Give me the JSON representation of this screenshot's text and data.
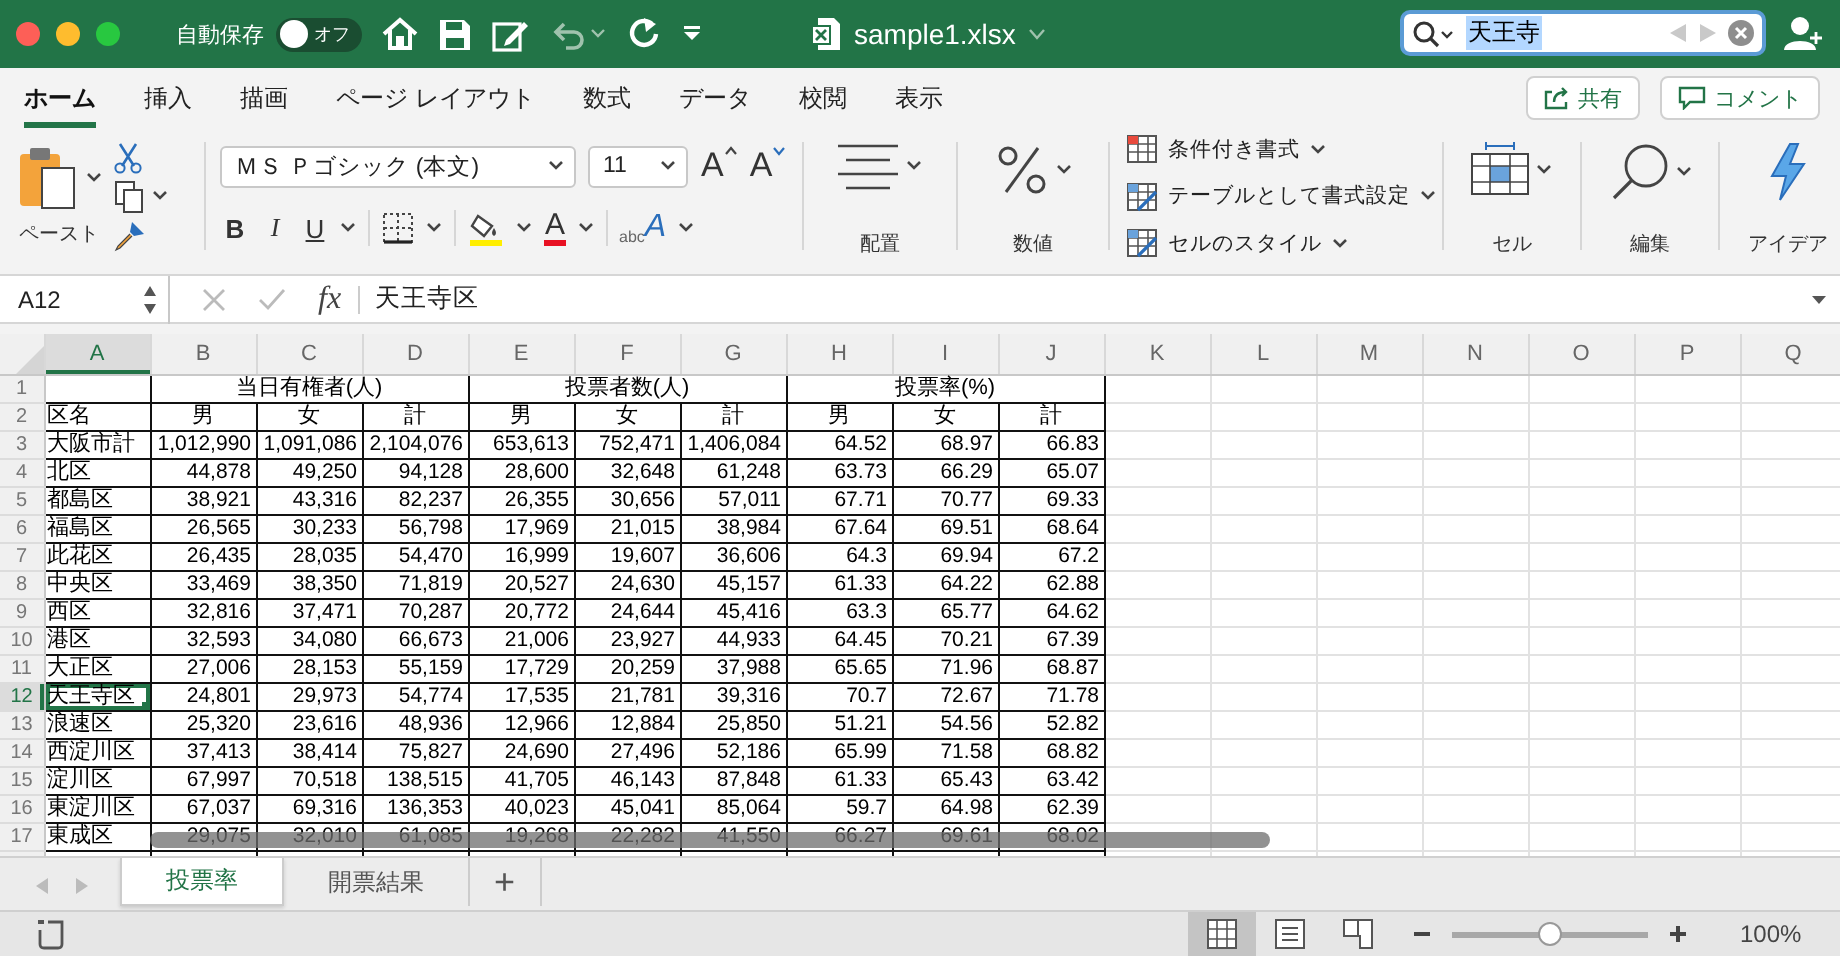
{
  "title_bar": {
    "autosave": {
      "label": "自動保存",
      "state_label": "オフ",
      "on": false
    },
    "filename": "sample1.xlsx",
    "search": {
      "value": "天王寺"
    }
  },
  "ribbon_tabs": [
    {
      "label": "ホーム",
      "selected": true
    },
    {
      "label": "挿入",
      "selected": false
    },
    {
      "label": "描画",
      "selected": false
    },
    {
      "label": "ページ レイアウト",
      "selected": false
    },
    {
      "label": "数式",
      "selected": false
    },
    {
      "label": "データ",
      "selected": false
    },
    {
      "label": "校閲",
      "selected": false
    },
    {
      "label": "表示",
      "selected": false
    }
  ],
  "share_button": "共有",
  "comment_button": "コメント",
  "ribbon": {
    "paste_label": "ペースト",
    "font_name": "ＭＳ Ｐゴシック (本文)",
    "font_size": "11",
    "grow_font": "A",
    "shrink_font": "A",
    "style_buttons": [
      "B",
      "I",
      "U"
    ],
    "font_color": "A",
    "orientation": {
      "small": "abc",
      "large": "A"
    },
    "alignment_label": "配置",
    "number_label": "数値",
    "styles": [
      "条件付き書式",
      "テーブルとして書式設定",
      "セルのスタイル"
    ],
    "cells_label": "セル",
    "editing_label": "編集",
    "ideas_label": "アイデア"
  },
  "formula_bar": {
    "name_box": "A12",
    "function_label": "fx",
    "formula": "天王寺区"
  },
  "sheet": {
    "columns": [
      {
        "letter": "A",
        "selected": true
      },
      {
        "letter": "B",
        "selected": false
      },
      {
        "letter": "C",
        "selected": false
      },
      {
        "letter": "D",
        "selected": false
      },
      {
        "letter": "E",
        "selected": false
      },
      {
        "letter": "F",
        "selected": false
      },
      {
        "letter": "G",
        "selected": false
      },
      {
        "letter": "H",
        "selected": false
      },
      {
        "letter": "I",
        "selected": false
      },
      {
        "letter": "J",
        "selected": false
      },
      {
        "letter": "K",
        "selected": false
      },
      {
        "letter": "L",
        "selected": false
      },
      {
        "letter": "M",
        "selected": false
      },
      {
        "letter": "N",
        "selected": false
      },
      {
        "letter": "O",
        "selected": false
      },
      {
        "letter": "P",
        "selected": false
      },
      {
        "letter": "Q",
        "selected": false
      }
    ],
    "header_rows": [
      {
        "number": "1",
        "selected": false
      },
      {
        "number": "2",
        "selected": false
      }
    ],
    "name_column_label": "区名",
    "groups": [
      {
        "label": "当日有権者(人)",
        "subcolumns": [
          "男",
          "女",
          "計"
        ]
      },
      {
        "label": "投票者数(人)",
        "subcolumns": [
          "男",
          "女",
          "計"
        ]
      },
      {
        "label": "投票率(%)",
        "subcolumns": [
          "男",
          "女",
          "計"
        ]
      }
    ],
    "rows": [
      {
        "number": "3",
        "selected": false,
        "cells": [
          "大阪市計",
          "1,012,990",
          "1,091,086",
          "2,104,076",
          "653,613",
          "752,471",
          "1,406,084",
          "64.52",
          "68.97",
          "66.83"
        ]
      },
      {
        "number": "4",
        "selected": false,
        "cells": [
          "北区",
          "44,878",
          "49,250",
          "94,128",
          "28,600",
          "32,648",
          "61,248",
          "63.73",
          "66.29",
          "65.07"
        ]
      },
      {
        "number": "5",
        "selected": false,
        "cells": [
          "都島区",
          "38,921",
          "43,316",
          "82,237",
          "26,355",
          "30,656",
          "57,011",
          "67.71",
          "70.77",
          "69.33"
        ]
      },
      {
        "number": "6",
        "selected": false,
        "cells": [
          "福島区",
          "26,565",
          "30,233",
          "56,798",
          "17,969",
          "21,015",
          "38,984",
          "67.64",
          "69.51",
          "68.64"
        ]
      },
      {
        "number": "7",
        "selected": false,
        "cells": [
          "此花区",
          "26,435",
          "28,035",
          "54,470",
          "16,999",
          "19,607",
          "36,606",
          "64.3",
          "69.94",
          "67.2"
        ]
      },
      {
        "number": "8",
        "selected": false,
        "cells": [
          "中央区",
          "33,469",
          "38,350",
          "71,819",
          "20,527",
          "24,630",
          "45,157",
          "61.33",
          "64.22",
          "62.88"
        ]
      },
      {
        "number": "9",
        "selected": false,
        "cells": [
          "西区",
          "32,816",
          "37,471",
          "70,287",
          "20,772",
          "24,644",
          "45,416",
          "63.3",
          "65.77",
          "64.62"
        ]
      },
      {
        "number": "10",
        "selected": false,
        "cells": [
          "港区",
          "32,593",
          "34,080",
          "66,673",
          "21,006",
          "23,927",
          "44,933",
          "64.45",
          "70.21",
          "67.39"
        ]
      },
      {
        "number": "11",
        "selected": false,
        "cells": [
          "大正区",
          "27,006",
          "28,153",
          "55,159",
          "17,729",
          "20,259",
          "37,988",
          "65.65",
          "71.96",
          "68.87"
        ]
      },
      {
        "number": "12",
        "selected": true,
        "cells": [
          "天王寺区",
          "24,801",
          "29,973",
          "54,774",
          "17,535",
          "21,781",
          "39,316",
          "70.7",
          "72.67",
          "71.78"
        ]
      },
      {
        "number": "13",
        "selected": false,
        "cells": [
          "浪速区",
          "25,320",
          "23,616",
          "48,936",
          "12,966",
          "12,884",
          "25,850",
          "51.21",
          "54.56",
          "52.82"
        ]
      },
      {
        "number": "14",
        "selected": false,
        "cells": [
          "西淀川区",
          "37,413",
          "38,414",
          "75,827",
          "24,690",
          "27,496",
          "52,186",
          "65.99",
          "71.58",
          "68.82"
        ]
      },
      {
        "number": "15",
        "selected": false,
        "cells": [
          "淀川区",
          "67,997",
          "70,518",
          "138,515",
          "41,705",
          "46,143",
          "87,848",
          "61.33",
          "65.43",
          "63.42"
        ]
      },
      {
        "number": "16",
        "selected": false,
        "cells": [
          "東淀川区",
          "67,037",
          "69,316",
          "136,353",
          "40,023",
          "45,041",
          "85,064",
          "59.7",
          "64.98",
          "62.39"
        ]
      },
      {
        "number": "17",
        "selected": false,
        "cells": [
          "東成区",
          "29,075",
          "32,010",
          "61,085",
          "19,268",
          "22,282",
          "41,550",
          "66.27",
          "69.61",
          "68.02"
        ]
      }
    ]
  },
  "sheet_tabs": [
    {
      "label": "投票率",
      "selected": true
    },
    {
      "label": "開票結果",
      "selected": false
    }
  ],
  "add_sheet": "+",
  "status_bar": {
    "views": [
      {
        "kind": "normal",
        "selected": true
      },
      {
        "kind": "page_layout",
        "selected": false
      },
      {
        "kind": "page_break",
        "selected": false
      }
    ],
    "zoom": {
      "level": 0.5
    },
    "zoom_label": "100%"
  }
}
